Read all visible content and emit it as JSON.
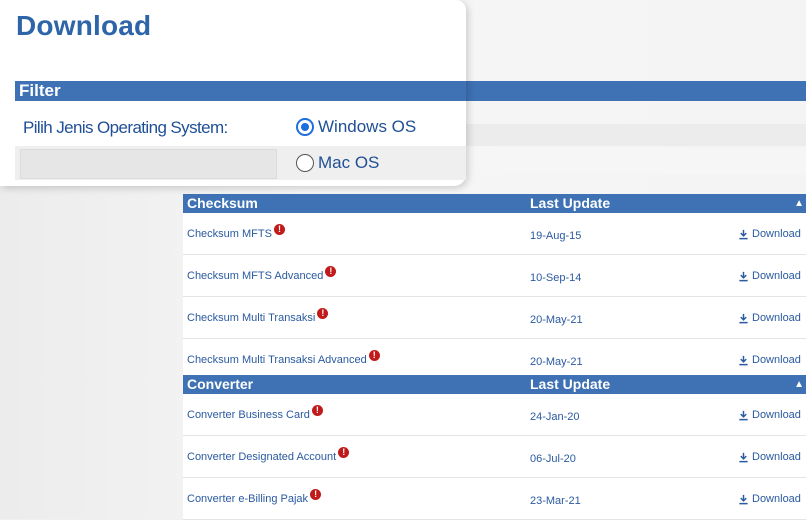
{
  "page": {
    "title": "Download"
  },
  "filter": {
    "header": "Filter",
    "os_label": "Pilih Jenis Operating System:",
    "options": [
      {
        "label": "Windows OS",
        "selected": true
      },
      {
        "label": "Mac OS",
        "selected": false
      }
    ]
  },
  "tables": [
    {
      "headers": [
        "Checksum",
        "Last Update"
      ],
      "rows": [
        {
          "name": "Checksum MFTS",
          "date": "19-Aug-15",
          "action": "Download"
        },
        {
          "name": "Checksum MFTS Advanced",
          "date": "10-Sep-14",
          "action": "Download"
        },
        {
          "name": "Checksum Multi Transaksi",
          "date": "20-May-21",
          "action": "Download"
        },
        {
          "name": "Checksum Multi Transaksi Advanced",
          "date": "20-May-21",
          "action": "Download"
        }
      ]
    },
    {
      "headers": [
        "Converter",
        "Last Update"
      ],
      "rows": [
        {
          "name": "Converter Business Card",
          "date": "24-Jan-20",
          "action": "Download"
        },
        {
          "name": "Converter Designated Account",
          "date": "06-Jul-20",
          "action": "Download"
        },
        {
          "name": "Converter e-Billing Pajak",
          "date": "23-Mar-21",
          "action": "Download"
        }
      ]
    }
  ],
  "colors": {
    "primary": "#3e72b4",
    "title": "#2e64a8",
    "info_badge": "#c11a1a",
    "radio": "#1d6fe0"
  },
  "icons": {
    "info": "info-icon",
    "download": "download-icon",
    "sort": "chevron-up-icon"
  }
}
